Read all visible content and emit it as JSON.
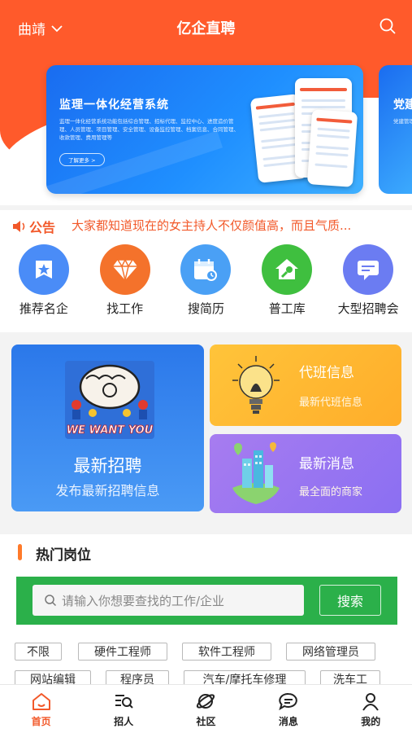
{
  "header": {
    "city": "曲靖",
    "title": "亿企直聘"
  },
  "banner": {
    "title": "监理一体化经营系统",
    "description": "监理一体化经营系统功能包括综合管理、招标代理、监控中心、进度造价管理、人员管理、项目管理、安全管理、设备监控管理、档案信息、合同管理、收款管理、费用管理等",
    "more": "了解更多 >",
    "next_title": "党建",
    "next_desc": "党建管理 廉，打造 个人中心"
  },
  "notice": {
    "label": "公告",
    "text": "大家都知道现在的女主持人不仅颜值高，而且气质..."
  },
  "quicknav": [
    {
      "label": "推荐名企",
      "icon": "star-badge-icon",
      "color": "#4a8cf7"
    },
    {
      "label": "找工作",
      "icon": "diamond-icon",
      "color": "#f4722b"
    },
    {
      "label": "搜简历",
      "icon": "calendar-search-icon",
      "color": "#4aa0f5"
    },
    {
      "label": "普工库",
      "icon": "house-key-icon",
      "color": "#3fbf3f"
    },
    {
      "label": "大型招聘会",
      "icon": "message-board-icon",
      "color": "#6b7cf2"
    }
  ],
  "features": {
    "main": {
      "title": "最新招聘",
      "subtitle": "发布最新招聘信息",
      "art_text": "WE WANT YOU"
    },
    "shift": {
      "title": "代班信息",
      "subtitle": "最新代班信息"
    },
    "news": {
      "title": "最新消息",
      "subtitle": "最全面的商家"
    }
  },
  "hot_jobs": {
    "title": "热门岗位",
    "search_placeholder": "请输入你想要查找的工作/企业",
    "search_button": "搜索",
    "tags": [
      "不限",
      "硬件工程师",
      "软件工程师",
      "网络管理员",
      "网站编辑",
      "程序员",
      "汽车/摩托车修理",
      "洗车工"
    ]
  },
  "tabbar": [
    {
      "label": "首页",
      "icon": "home-icon",
      "active": true
    },
    {
      "label": "招人",
      "icon": "search-list-icon",
      "active": false
    },
    {
      "label": "社区",
      "icon": "planet-icon",
      "active": false
    },
    {
      "label": "消息",
      "icon": "chat-bubble-icon",
      "active": false
    },
    {
      "label": "我的",
      "icon": "user-icon",
      "active": false
    }
  ],
  "colors": {
    "brand": "#ff5a2b",
    "notice": "#f2592a",
    "search_panel": "#2bb04a",
    "active_tab": "#f2592a"
  }
}
